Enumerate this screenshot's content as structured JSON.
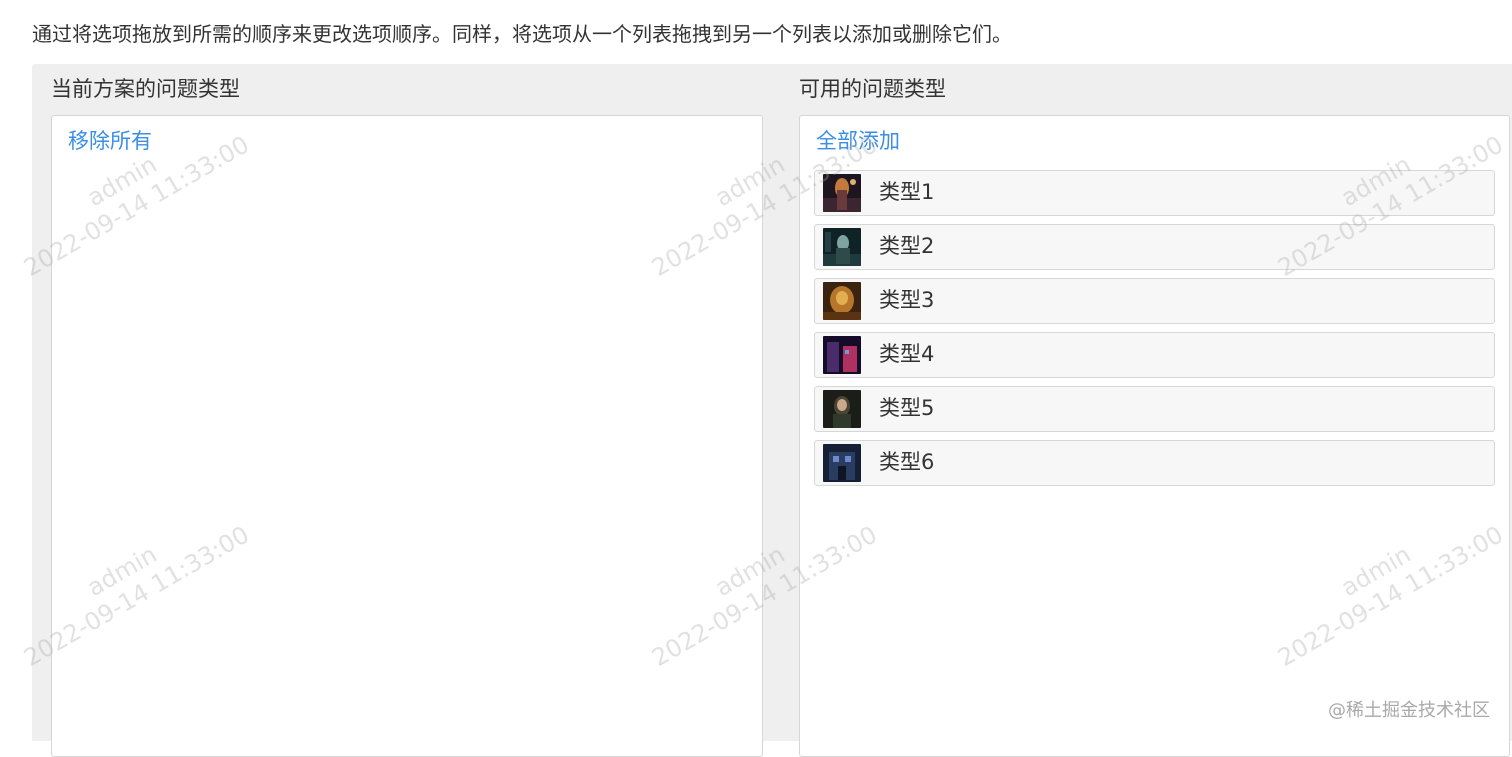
{
  "instructions": "通过将选项拖放到所需的顺序来更改选项顺序。同样，将选项从一个列表拖拽到另一个列表以添加或删除它们。",
  "left_panel": {
    "title": "当前方案的问题类型",
    "action": "移除所有",
    "items": []
  },
  "right_panel": {
    "title": "可用的问题类型",
    "action": "全部添加",
    "items": [
      {
        "label": "类型1"
      },
      {
        "label": "类型2"
      },
      {
        "label": "类型3"
      },
      {
        "label": "类型4"
      },
      {
        "label": "类型5"
      },
      {
        "label": "类型6"
      }
    ]
  },
  "watermark": {
    "user": "admin",
    "timestamp": "2022-09-14 11:33:00"
  },
  "credit": "@稀土掘金技术社区",
  "colors": {
    "link": "#3a8ee6",
    "panel_bg": "#efefef",
    "item_bg": "#f7f7f7",
    "border": "#d6d6d6"
  },
  "icons": [
    "thumbnail-image"
  ]
}
